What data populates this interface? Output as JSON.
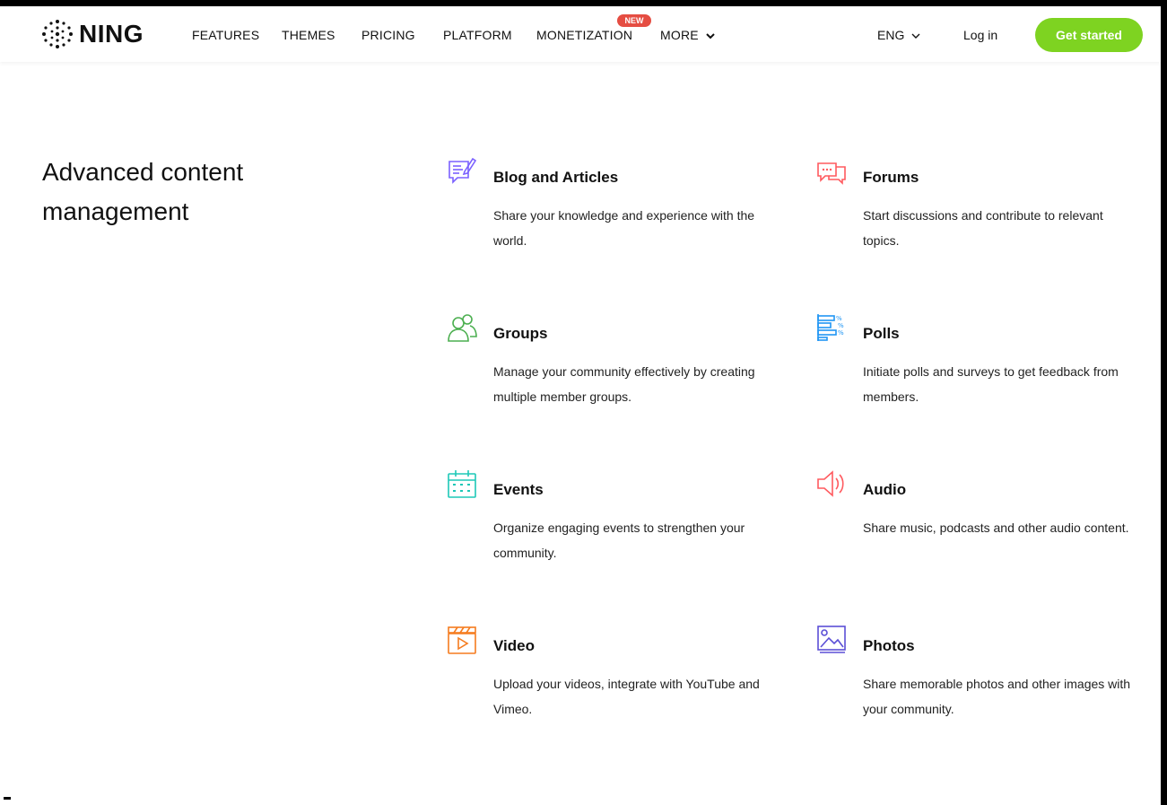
{
  "header": {
    "logo_text": "NING",
    "nav": [
      "FEATURES",
      "THEMES",
      "PRICING",
      "PLATFORM",
      "MONETIZATION",
      "MORE"
    ],
    "badge": "NEW",
    "lang": "ENG",
    "login": "Log in",
    "cta": "Get started"
  },
  "main": {
    "title": "Advanced content management",
    "features": [
      {
        "icon": "blog-icon",
        "title": "Blog and Articles",
        "desc": "Share your knowledge and experience with the world.",
        "color": "#7b61ff"
      },
      {
        "icon": "forums-icon",
        "title": "Forums",
        "desc": "Start discussions and contribute to relevant topics.",
        "color": "#ff5a5f"
      },
      {
        "icon": "groups-icon",
        "title": "Groups",
        "desc": "Manage your community effectively by creating multiple member groups.",
        "color": "#4caf50"
      },
      {
        "icon": "polls-icon",
        "title": "Polls",
        "desc": "Initiate polls and surveys to get feedback from members.",
        "color": "#2196f3"
      },
      {
        "icon": "events-icon",
        "title": "Events",
        "desc": "Organize engaging events to strengthen your community.",
        "color": "#1ec8b7"
      },
      {
        "icon": "audio-icon",
        "title": "Audio",
        "desc": "Share music, podcasts and other audio content.",
        "color": "#ff5a5f"
      },
      {
        "icon": "video-icon",
        "title": "Video",
        "desc": "Upload your videos, integrate with YouTube and Vimeo.",
        "color": "#f57c1f"
      },
      {
        "icon": "photos-icon",
        "title": "Photos",
        "desc": "Share memorable photos and other images with your community.",
        "color": "#5b4fd6"
      }
    ]
  },
  "colors": {
    "accent": "#7ed321",
    "badge": "#e54d42"
  }
}
